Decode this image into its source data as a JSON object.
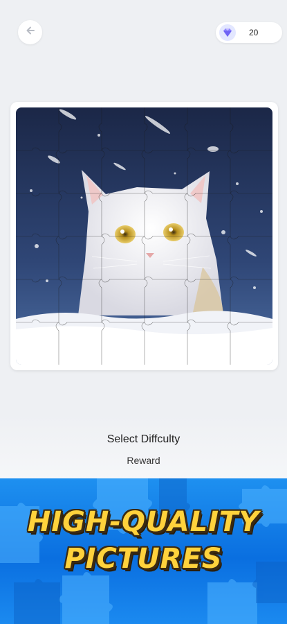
{
  "header": {
    "back_icon": "arrow-left-icon",
    "gems": {
      "icon": "diamond-icon",
      "count": "20"
    }
  },
  "puzzle": {
    "image_subject": "white-cat-in-snow",
    "colors": {
      "sky_top": "#1b2747",
      "sky_bottom": "#3d5b8e",
      "snow": "#f1f3f8",
      "cat": "#f4f2f0",
      "eyes": "#d8b240"
    }
  },
  "difficulty": {
    "title": "Select Diffculty",
    "level": "Reward"
  },
  "promo": {
    "line1": "HIGH-QUALITY",
    "line2": "PICTURES",
    "colors": {
      "banner": "#0a6fe0",
      "text": "#ffd23c",
      "outline": "#3a2a12"
    }
  }
}
